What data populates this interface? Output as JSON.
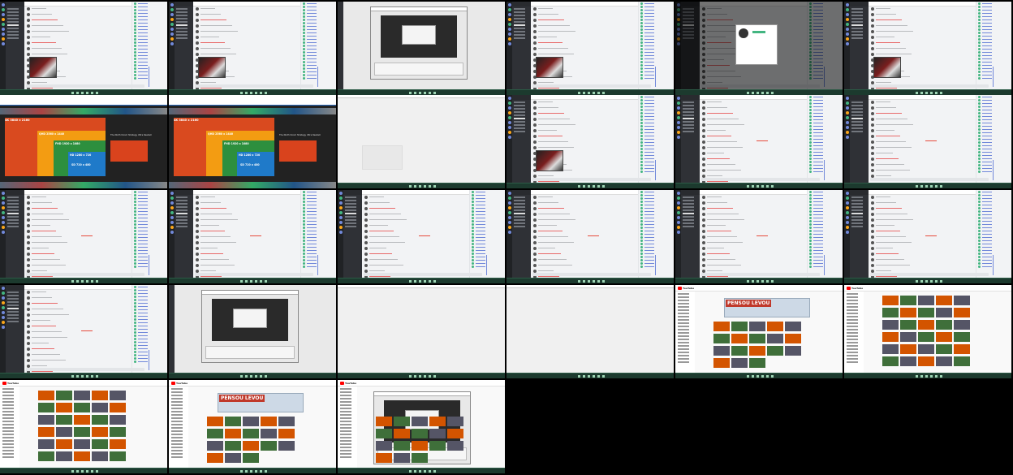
{
  "grid": {
    "columns": 6,
    "rows": 5,
    "tiles_shown": 27
  },
  "tiles": [
    {
      "kind": "discord",
      "variant": "image"
    },
    {
      "kind": "discord",
      "variant": "image"
    },
    {
      "kind": "editor"
    },
    {
      "kind": "discord",
      "variant": "image"
    },
    {
      "kind": "discord",
      "variant": "popup"
    },
    {
      "kind": "discord",
      "variant": "image"
    },
    {
      "kind": "resolution"
    },
    {
      "kind": "resolution"
    },
    {
      "kind": "blank",
      "variant": "ghost"
    },
    {
      "kind": "discord",
      "variant": "image"
    },
    {
      "kind": "discord",
      "variant": "plain"
    },
    {
      "kind": "discord",
      "variant": "list"
    },
    {
      "kind": "discord",
      "variant": "plain"
    },
    {
      "kind": "discord",
      "variant": "plain"
    },
    {
      "kind": "discord",
      "variant": "plain"
    },
    {
      "kind": "discord",
      "variant": "plain"
    },
    {
      "kind": "discord",
      "variant": "plain"
    },
    {
      "kind": "discord",
      "variant": "plain"
    },
    {
      "kind": "discord",
      "variant": "plain"
    },
    {
      "kind": "editor"
    },
    {
      "kind": "blank"
    },
    {
      "kind": "blank"
    },
    {
      "kind": "youtube",
      "variant": "banner"
    },
    {
      "kind": "youtube",
      "variant": "grid"
    },
    {
      "kind": "youtube",
      "variant": "grid"
    },
    {
      "kind": "youtube",
      "variant": "banner"
    },
    {
      "kind": "youtube",
      "variant": "editor"
    }
  ],
  "resolution_chart": {
    "title": "4K  3840 x 2160",
    "rows": [
      "QHD  2560 x 1440",
      "FHD  1920 x 1080",
      "HD  1280 x 720",
      "SD  720 x 480"
    ],
    "side_caption": "The Ninth Doom Strategy Ultra Realism"
  },
  "youtube": {
    "logo": "YouTube",
    "banner_text": "PENSOU LEVOU"
  },
  "colors": {
    "discord_sidebar": "#202225",
    "discord_channels": "#2f3136",
    "discord_accent": "#7289da",
    "online": "#43b581",
    "youtube_red": "#ff0000",
    "taskbar": "#1c3a2e"
  }
}
